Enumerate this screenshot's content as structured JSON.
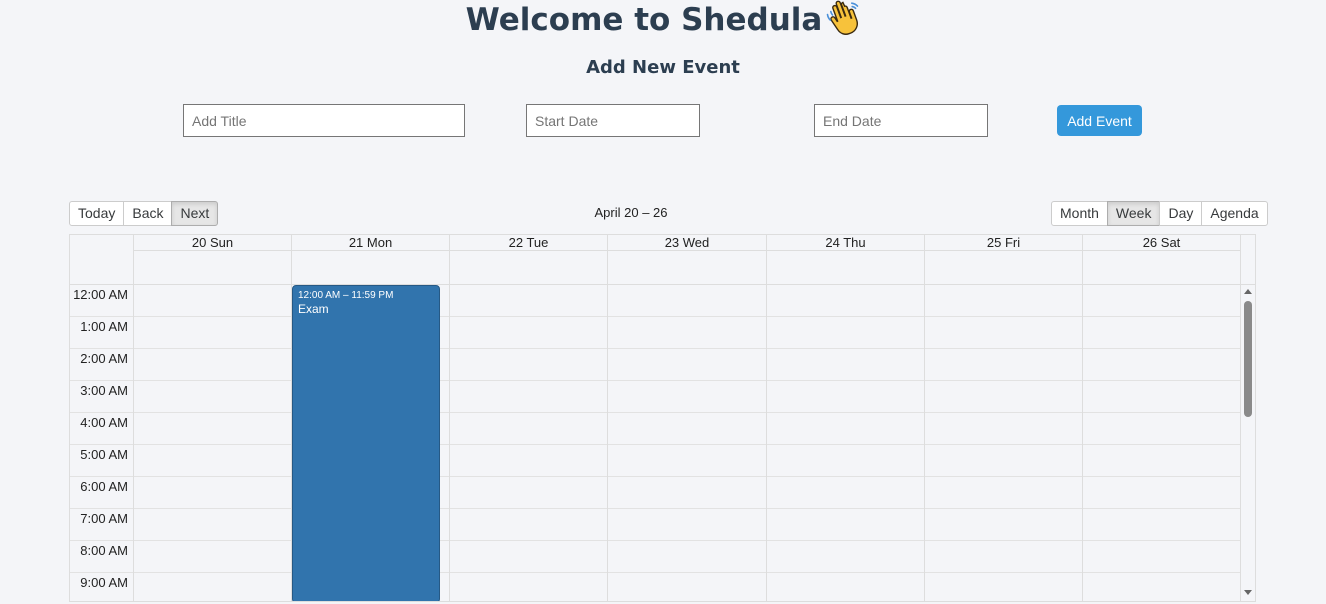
{
  "header": {
    "title": "Welcome to Shedula",
    "emoji": "waving-hand-icon",
    "subtitle": "Add New Event"
  },
  "form": {
    "title_placeholder": "Add Title",
    "start_placeholder": "Start Date",
    "end_placeholder": "End Date",
    "add_label": "Add Event"
  },
  "toolbar": {
    "today": "Today",
    "back": "Back",
    "next": "Next",
    "label": "April 20 – 26",
    "views": {
      "month": "Month",
      "week": "Week",
      "day": "Day",
      "agenda": "Agenda"
    },
    "active_view": "Week"
  },
  "calendar": {
    "days": [
      "20 Sun",
      "21 Mon",
      "22 Tue",
      "23 Wed",
      "24 Thu",
      "25 Fri",
      "26 Sat"
    ],
    "times": [
      "12:00 AM",
      "1:00 AM",
      "2:00 AM",
      "3:00 AM",
      "4:00 AM",
      "5:00 AM",
      "6:00 AM",
      "7:00 AM",
      "8:00 AM",
      "9:00 AM"
    ],
    "event": {
      "time": "12:00 AM – 11:59 PM",
      "title": "Exam",
      "day": "21 Mon"
    }
  },
  "colors": {
    "accent": "#3498db",
    "event": "#3174ad",
    "heading": "#2c3e50"
  }
}
